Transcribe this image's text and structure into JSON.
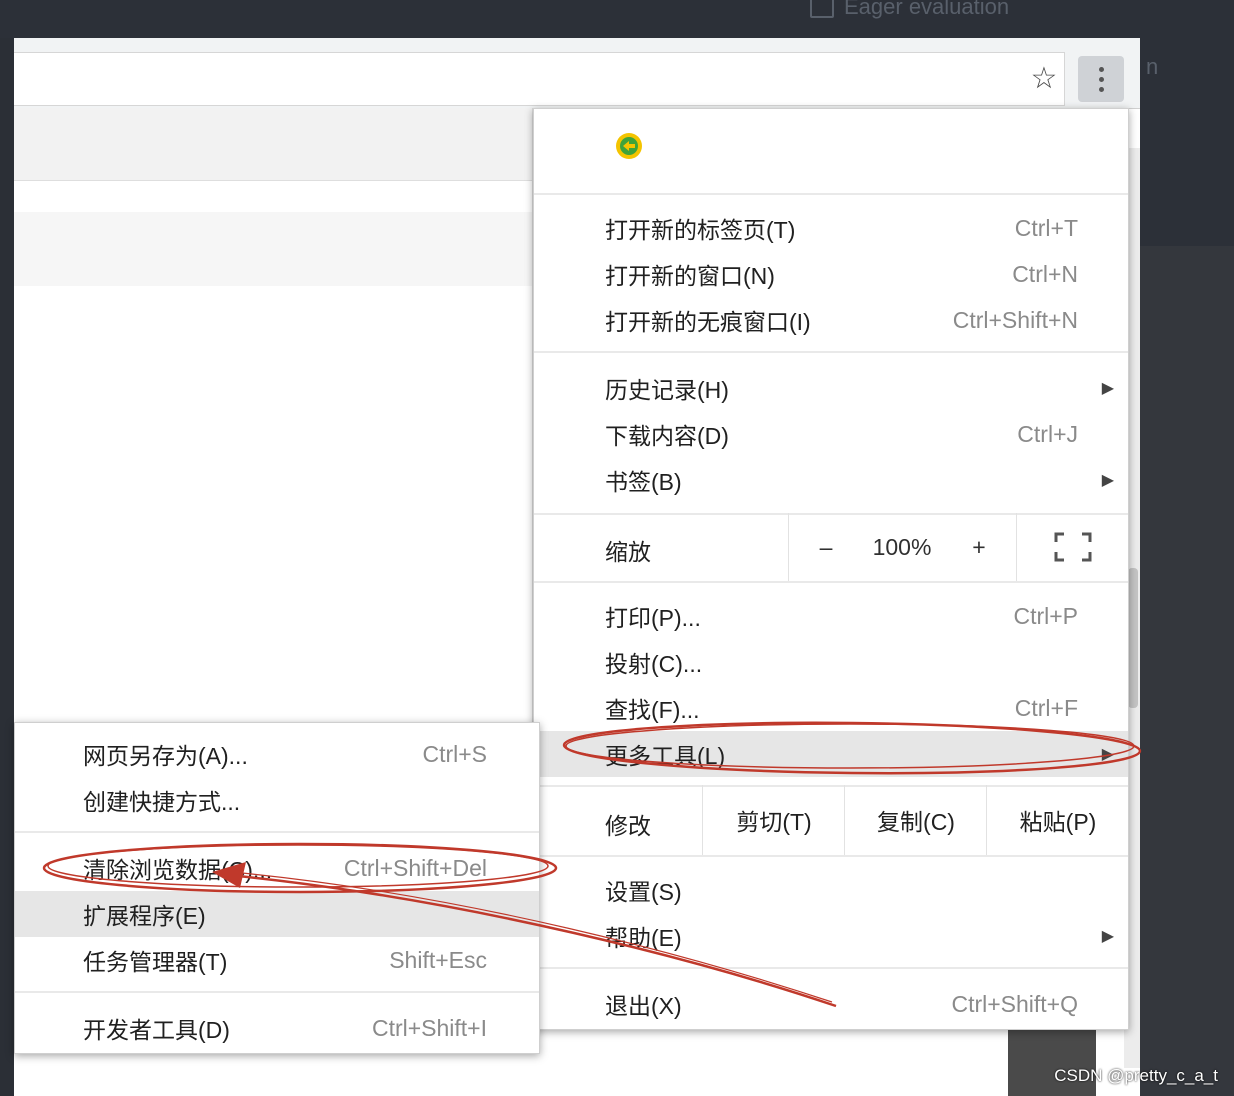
{
  "background": {
    "eager_label": "Eager evaluation",
    "right_fragment": "n"
  },
  "browser": {
    "star_icon": "star-icon",
    "menu_icon": "kebab-icon"
  },
  "main_menu": {
    "logo_icon": "360-logo-icon",
    "groups": [
      {
        "items": [
          {
            "label": "打开新的标签页(T)",
            "shortcut": "Ctrl+T",
            "submenu": false
          },
          {
            "label": "打开新的窗口(N)",
            "shortcut": "Ctrl+N",
            "submenu": false
          },
          {
            "label": "打开新的无痕窗口(I)",
            "shortcut": "Ctrl+Shift+N",
            "submenu": false
          }
        ]
      },
      {
        "items": [
          {
            "label": "历史记录(H)",
            "shortcut": "",
            "submenu": true
          },
          {
            "label": "下载内容(D)",
            "shortcut": "Ctrl+J",
            "submenu": false
          },
          {
            "label": "书签(B)",
            "shortcut": "",
            "submenu": true
          }
        ]
      }
    ],
    "zoom": {
      "label": "缩放",
      "minus": "–",
      "value": "100%",
      "plus": "+",
      "fullscreen_icon": "fullscreen-icon"
    },
    "group3": [
      {
        "label": "打印(P)...",
        "shortcut": "Ctrl+P"
      },
      {
        "label": "投射(C)...",
        "shortcut": ""
      },
      {
        "label": "查找(F)...",
        "shortcut": "Ctrl+F"
      },
      {
        "label": "更多工具(L)",
        "shortcut": "",
        "submenu": true
      }
    ],
    "edit": {
      "label": "修改",
      "cut": "剪切(T)",
      "copy": "复制(C)",
      "paste": "粘贴(P)"
    },
    "group4": [
      {
        "label": "设置(S)",
        "shortcut": ""
      },
      {
        "label": "帮助(E)",
        "shortcut": "",
        "submenu": true
      }
    ],
    "exit": {
      "label": "退出(X)",
      "shortcut": "Ctrl+Shift+Q"
    }
  },
  "more_tools_menu": {
    "items": [
      {
        "label": "网页另存为(A)...",
        "shortcut": "Ctrl+S"
      },
      {
        "label": "创建快捷方式...",
        "shortcut": ""
      },
      {
        "label": "清除浏览数据(C)...",
        "shortcut": "Ctrl+Shift+Del"
      },
      {
        "label": "扩展程序(E)",
        "shortcut": ""
      },
      {
        "label": "任务管理器(T)",
        "shortcut": "Shift+Esc"
      },
      {
        "label": "开发者工具(D)",
        "shortcut": "Ctrl+Shift+I"
      }
    ]
  },
  "annotation_color": "#c0392b",
  "watermark": "CSDN @pretty_c_a_t"
}
